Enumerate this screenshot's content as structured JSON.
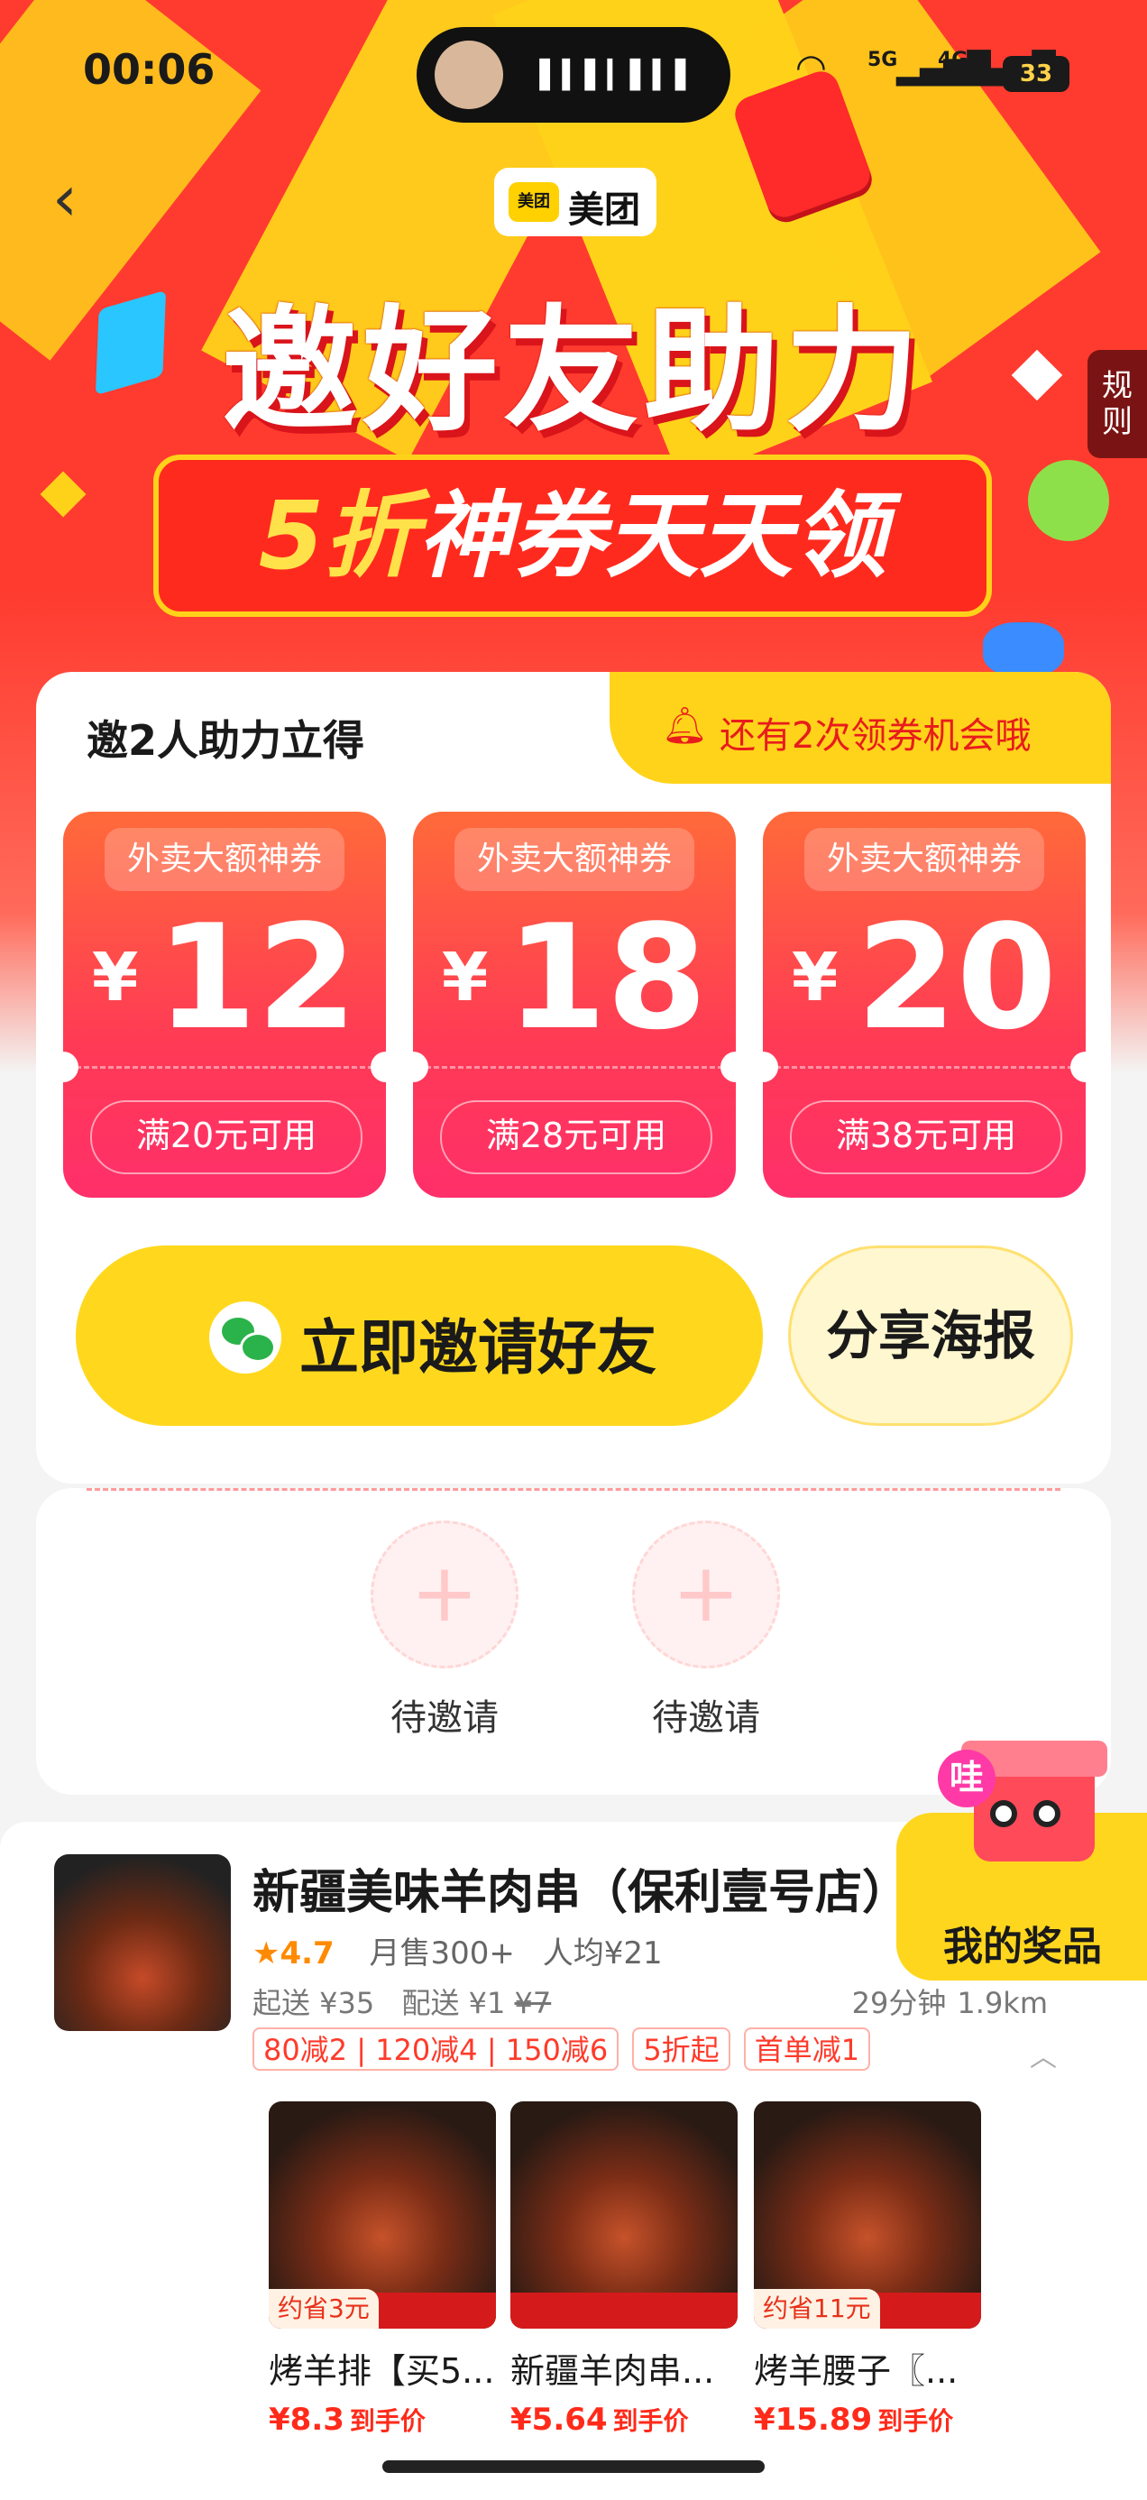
{
  "status_bar": {
    "time": "00:06",
    "signal_1": "5G",
    "signal_2": "4G",
    "battery": "33"
  },
  "brand": {
    "logo_text": "美团",
    "name": "美团"
  },
  "banner": {
    "headline": "邀好友助力",
    "sub_highlight": "5折",
    "sub_rest": "神券天天领"
  },
  "rules_label": "规则",
  "card": {
    "title": "邀2人助力立得",
    "chance_text": "还有2次领券机会哦",
    "coupons": [
      {
        "head": "外卖大额神券",
        "yen": "¥",
        "amount": "12",
        "condition": "满20元可用"
      },
      {
        "head": "外卖大额神券",
        "yen": "¥",
        "amount": "18",
        "condition": "满28元可用"
      },
      {
        "head": "外卖大额神券",
        "yen": "¥",
        "amount": "20",
        "condition": "满38元可用"
      }
    ],
    "invite_label": "立即邀请好友",
    "poster_label": "分享海报"
  },
  "slots": [
    {
      "label": "待邀请"
    },
    {
      "label": "待邀请"
    }
  ],
  "prize": {
    "badge": "哇",
    "label": "我的奖品"
  },
  "shop": {
    "name": "新疆美味羊肉串（保利壹号店）",
    "rating": "4.7",
    "monthly_sales": "月售300+",
    "avg_price": "人均¥21",
    "min_order": "起送 ¥35",
    "delivery_label": "配送 ¥1",
    "delivery_original": "¥7",
    "eta": "29分钟",
    "distance": "1.9km",
    "tags": [
      "80减2 | 120减4 | 150减6",
      "5折起",
      "首单减1"
    ],
    "products": [
      {
        "saving": "约省3元",
        "name": "烤羊排【买5...",
        "price": "¥8.3",
        "price_unit": "到手价"
      },
      {
        "saving": "",
        "name": "新疆羊肉串...",
        "price": "¥5.64",
        "price_unit": "到手价"
      },
      {
        "saving": "约省11元",
        "name": "烤羊腰子〖...",
        "price": "¥15.89",
        "price_unit": "到手价"
      }
    ]
  }
}
